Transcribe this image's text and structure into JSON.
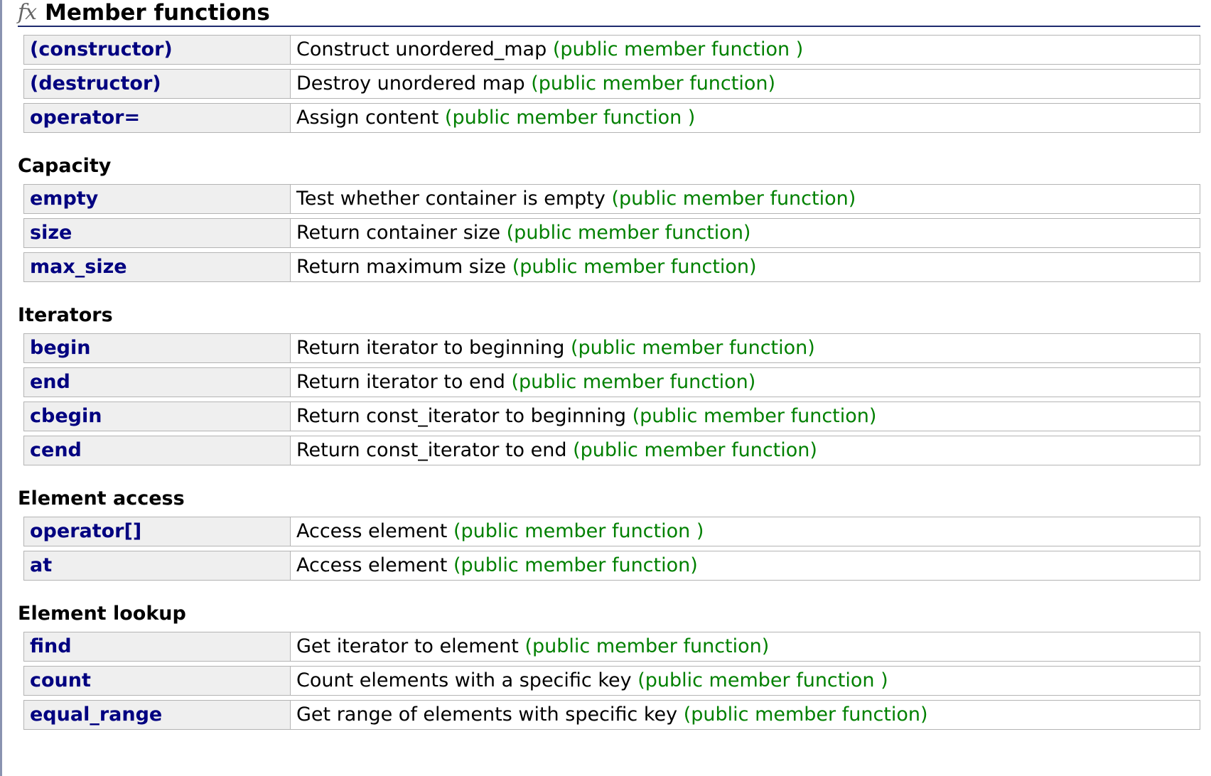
{
  "section": {
    "icon": "fx",
    "title": "Member functions"
  },
  "groups": [
    {
      "title": "",
      "rows": [
        {
          "name": "(constructor)",
          "desc": "Construct unordered_map",
          "kind": "(public member function )"
        },
        {
          "name": "(destructor)",
          "desc": "Destroy unordered map",
          "kind": "(public member function)"
        },
        {
          "name": "operator=",
          "desc": "Assign content",
          "kind": "(public member function )"
        }
      ]
    },
    {
      "title": "Capacity",
      "rows": [
        {
          "name": "empty",
          "desc": "Test whether container is empty",
          "kind": "(public member function)"
        },
        {
          "name": "size",
          "desc": "Return container size",
          "kind": "(public member function)"
        },
        {
          "name": "max_size",
          "desc": "Return maximum size",
          "kind": "(public member function)"
        }
      ]
    },
    {
      "title": "Iterators",
      "rows": [
        {
          "name": "begin",
          "desc": "Return iterator to beginning",
          "kind": "(public member function)"
        },
        {
          "name": "end",
          "desc": "Return iterator to end",
          "kind": "(public member function)"
        },
        {
          "name": "cbegin",
          "desc": "Return const_iterator to beginning",
          "kind": "(public member function)"
        },
        {
          "name": "cend",
          "desc": "Return const_iterator to end",
          "kind": "(public member function)"
        }
      ]
    },
    {
      "title": "Element access",
      "rows": [
        {
          "name": "operator[]",
          "desc": "Access element",
          "kind": "(public member function )"
        },
        {
          "name": "at",
          "desc": "Access element",
          "kind": "(public member function)"
        }
      ]
    },
    {
      "title": "Element lookup",
      "rows": [
        {
          "name": "find",
          "desc": "Get iterator to element",
          "kind": "(public member function)"
        },
        {
          "name": "count",
          "desc": "Count elements with a specific key",
          "kind": "(public member function )"
        },
        {
          "name": "equal_range",
          "desc": "Get range of elements with specific key",
          "kind": "(public member function)"
        }
      ]
    }
  ]
}
